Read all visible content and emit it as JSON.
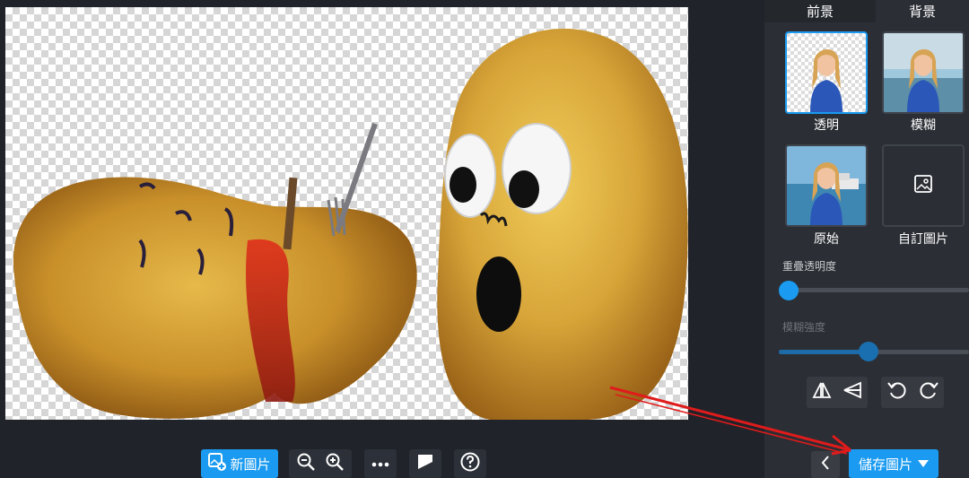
{
  "toolbar": {
    "new_image_label": "新圖片"
  },
  "panel": {
    "tabs": [
      {
        "label": "前景"
      },
      {
        "label": "背景"
      }
    ],
    "backgrounds": [
      {
        "label": "透明",
        "selected": true
      },
      {
        "label": "模糊",
        "selected": false
      },
      {
        "label": "原始",
        "selected": false
      },
      {
        "label": "自訂圖片",
        "selected": false
      }
    ],
    "opacity_label": "重疊透明度",
    "opacity_value": 0,
    "blur_label": "模糊強度",
    "blur_value": 0.47
  },
  "footer": {
    "save_label": "儲存圖片"
  },
  "colors": {
    "accent": "#1a9af0",
    "panel_bg": "#2b2e34",
    "app_bg": "#202329",
    "arrow": "#e01b1b"
  }
}
